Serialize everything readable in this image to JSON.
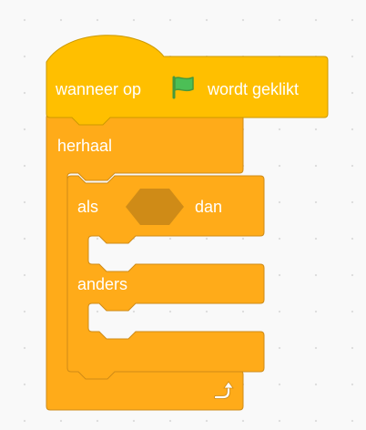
{
  "script": {
    "hat_block": {
      "text_before": "wanneer op",
      "icon": "green-flag-icon",
      "text_after": "wordt geklikt",
      "color": "#FFBF00"
    },
    "repeat_block": {
      "label": "herhaal",
      "loop_icon": "loop-arrow-icon",
      "color": "#FFAB19"
    },
    "if_else_block": {
      "if_label": "als",
      "then_label": "dan",
      "else_label": "anders",
      "condition_slot": "empty-boolean-slot",
      "color": "#FFAB19"
    }
  },
  "colors": {
    "workspace_bg": "#F9F9F9",
    "control_stroke": "#CF8B17",
    "event_stroke": "#CC9900",
    "empty_slot": "#CF8B17",
    "flag_green": "#4CBF56"
  }
}
